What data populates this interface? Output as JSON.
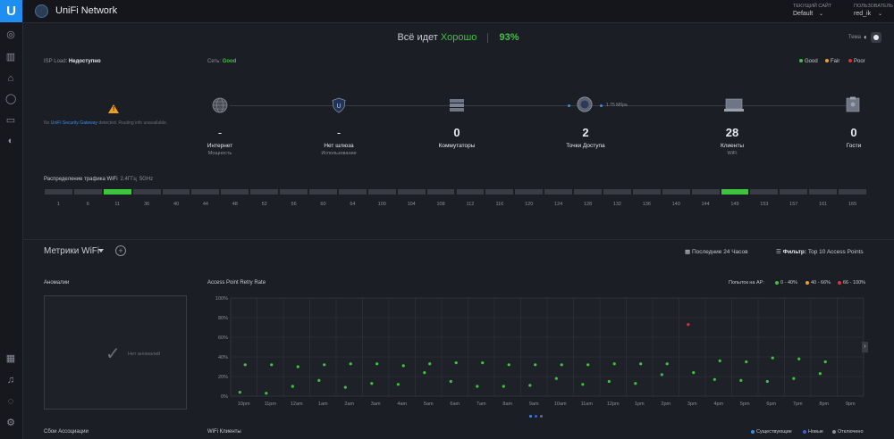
{
  "app": {
    "logo_letter": "U",
    "title": "UniFi Network"
  },
  "header": {
    "site_label": "ТЕКУЩИЙ САЙТ",
    "site_value": "Default",
    "user_label": "ПОЛЬЗОВАТЕЛЬ",
    "user_value": "red_ik"
  },
  "status": {
    "prefix": "Всё идет",
    "word": "Хорошо",
    "percent": "93%"
  },
  "theme": {
    "label": "Тема"
  },
  "isp": {
    "label": "ISP Load:",
    "value": "Недоступно",
    "msg_prefix": "No",
    "msg_link": "UniFi Security Gateway",
    "msg_suffix": "detected. Routing info unavailable."
  },
  "network": {
    "label": "Сеть:",
    "value": "Good"
  },
  "health_legend": [
    {
      "label": "Good",
      "color": "#3ec43e"
    },
    {
      "label": "Fair",
      "color": "#f0a020"
    },
    {
      "label": "Poor",
      "color": "#e03030"
    }
  ],
  "hubs": [
    {
      "value": "-",
      "label": "Интернет",
      "sub": "Мощность",
      "icon": "globe-icon"
    },
    {
      "value": "-",
      "label": "Нет шлюза",
      "sub": "Использование",
      "icon": "shield-icon"
    },
    {
      "value": "0",
      "label": "Коммутаторы",
      "sub": "",
      "icon": "switch-icon"
    },
    {
      "value": "2",
      "label": "Точки Доступа",
      "sub": "",
      "icon": "access-point-icon"
    },
    {
      "value": "28",
      "label": "Клиенты",
      "sub": "WiFi",
      "icon": "laptop-icon"
    },
    {
      "value": "0",
      "label": "Гости",
      "sub": "",
      "icon": "badge-icon"
    }
  ],
  "ap_speed": "1.75 Мбра",
  "wifi_dist": {
    "title": "Распределение трафика WiFi",
    "band1": "2.4ГГц",
    "band2": "5GHz"
  },
  "channels": {
    "ch24": [
      "1",
      "6",
      "11"
    ],
    "ch5": [
      "36",
      "40",
      "44",
      "48",
      "52",
      "56",
      "60",
      "64",
      "100",
      "104",
      "108",
      "112",
      "116",
      "120",
      "124",
      "128",
      "132",
      "136",
      "140",
      "144",
      "149",
      "153",
      "157",
      "161",
      "165"
    ],
    "active": [
      "11",
      "149"
    ]
  },
  "metrics": {
    "title": "Метрики WiFi",
    "period": "Последние 24 Часов",
    "filter_label": "Фильтр:",
    "filter_value": "Top 10 Access Points"
  },
  "anomalies": {
    "title": "Аномалии",
    "empty": "Нет аномалий"
  },
  "retry_chart": {
    "title": "Access Point Retry Rate",
    "legend_label": "Попыток на AP:"
  },
  "chart_data": {
    "type": "scatter",
    "title": "Access Point Retry Rate",
    "x": [
      "10pm",
      "11pm",
      "12am",
      "1am",
      "2am",
      "3am",
      "4am",
      "5am",
      "6am",
      "7am",
      "8am",
      "9am",
      "10am",
      "11am",
      "12pm",
      "1pm",
      "2pm",
      "3pm",
      "4pm",
      "5pm",
      "6pm",
      "7pm",
      "8pm",
      "9pm"
    ],
    "ylim": [
      0,
      100
    ],
    "yticks": [
      "100%",
      "80%",
      "60%",
      "40%",
      "20%",
      "0%"
    ],
    "grid": true,
    "legend": [
      {
        "label": "0 - 40%",
        "color": "#3ec43e"
      },
      {
        "label": "40 - 66%",
        "color": "#f0a020"
      },
      {
        "label": "66 - 100%",
        "color": "#e03030"
      }
    ],
    "series": [
      {
        "values": [
          32,
          32,
          30,
          32,
          33,
          33,
          31,
          33,
          34,
          34,
          32,
          32,
          32,
          32,
          33,
          33,
          33,
          24,
          36,
          35,
          39,
          38,
          35,
          null
        ]
      },
      {
        "values": [
          4,
          3,
          10,
          16,
          9,
          13,
          12,
          24,
          15,
          10,
          10,
          11,
          18,
          12,
          15,
          13,
          22,
          null,
          17,
          16,
          15,
          18,
          23,
          null
        ]
      },
      {
        "values": [
          null,
          null,
          null,
          null,
          null,
          null,
          null,
          null,
          null,
          null,
          null,
          null,
          null,
          null,
          null,
          null,
          null,
          73,
          null,
          null,
          null,
          null,
          null,
          null
        ]
      }
    ]
  },
  "footer": {
    "assoc_title": "Сбои Ассоциации",
    "clients_title": "WiFi Клиенты",
    "legend": [
      {
        "label": "Существующие",
        "color": "#3a8ee6"
      },
      {
        "label": "Новые",
        "color": "#3a5fe0"
      },
      {
        "label": "Отключено",
        "color": "#8b8e99"
      }
    ]
  }
}
